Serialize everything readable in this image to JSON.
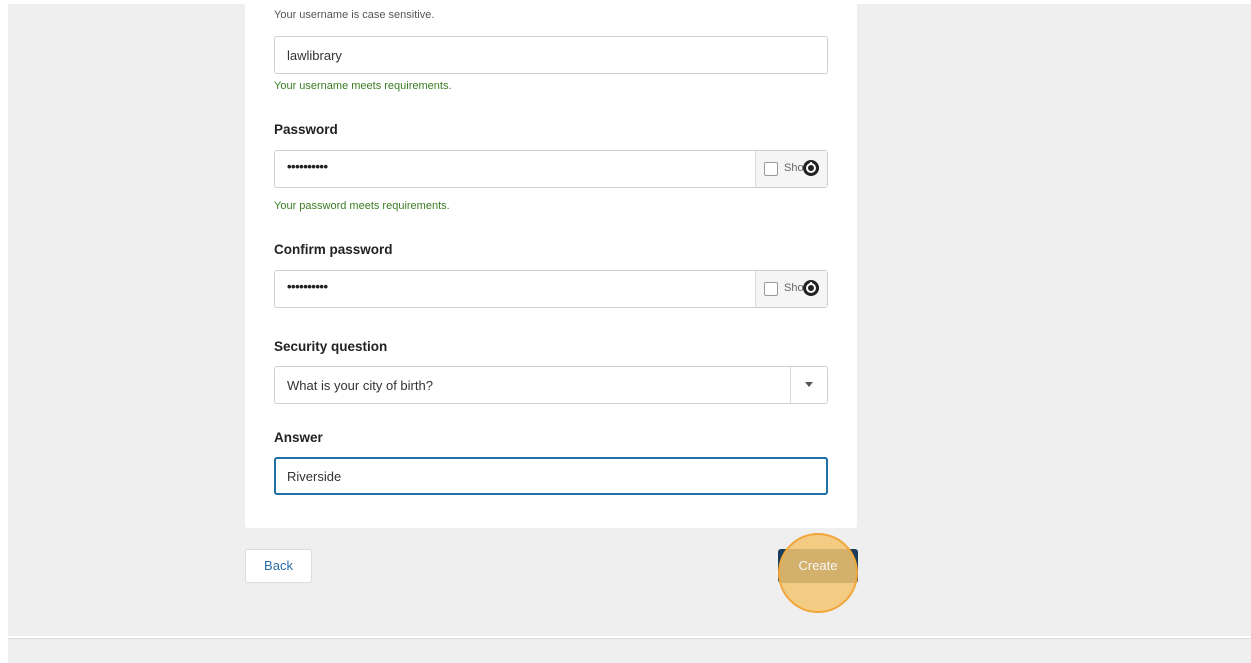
{
  "form": {
    "username_hint": "Your username is case sensitive.",
    "username_value": "lawlibrary",
    "username_status": "Your username meets requirements.",
    "password_label": "Password",
    "password_value": "••••••••••",
    "password_show_label": "Sho",
    "password_status": "Your password meets requirements.",
    "confirm_label": "Confirm password",
    "confirm_value": "••••••••••",
    "confirm_show_label": "Sho",
    "security_label": "Security question",
    "security_selected": "What is your city of birth?",
    "answer_label": "Answer",
    "answer_value": "Riverside"
  },
  "actions": {
    "back_label": "Back",
    "create_label": "Create"
  },
  "colors": {
    "success": "#3b7d23",
    "primary": "#1a3d5c",
    "link": "#2a6da8",
    "focus": "#1f6ea7",
    "highlight": "#f4c46e"
  }
}
